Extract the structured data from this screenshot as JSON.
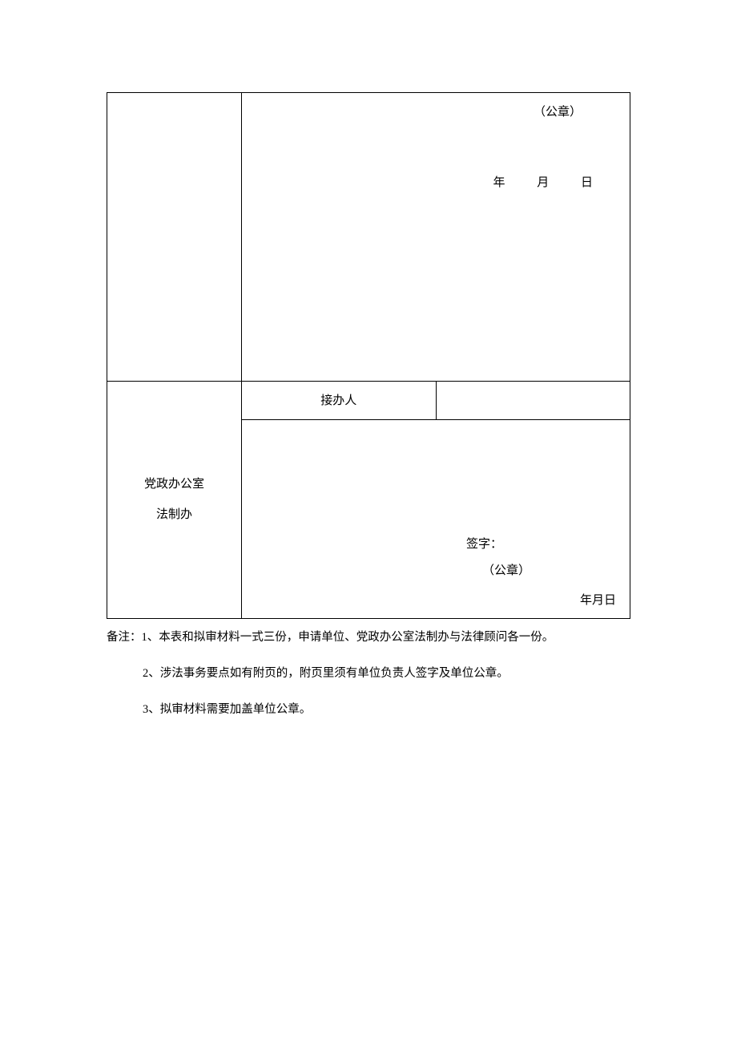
{
  "table": {
    "row1": {
      "seal": "（公章）",
      "year": "年",
      "month": "月",
      "day": "日"
    },
    "row2": {
      "left_line1": "党政办公室",
      "left_line2": "法制办",
      "receiver_label": "接办人",
      "signature_label": "签字：",
      "seal": "（公章）",
      "date": "年月日"
    }
  },
  "notes": {
    "note1": "备注：1、本表和拟审材料一式三份，申请单位、党政办公室法制办与法律顾问各一份。",
    "note2": "2、涉法事务要点如有附页的，附页里须有单位负责人签字及单位公章。",
    "note3": "3、拟审材料需要加盖单位公章。"
  }
}
